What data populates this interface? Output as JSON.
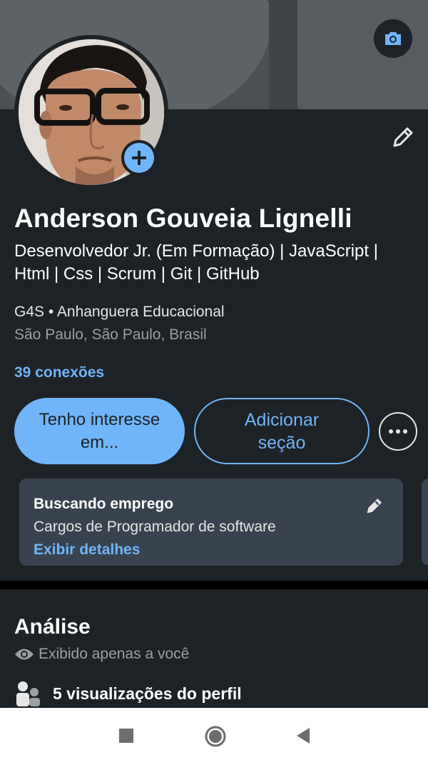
{
  "banner": {
    "camera_icon": "camera-icon"
  },
  "profile": {
    "name": "Anderson Gouveia Lignelli",
    "headline": "Desenvolvedor Jr. (Em Formação) | JavaScript | Html | Css | Scrum | Git | GitHub",
    "org": "G4S • Anhanguera Educacional",
    "location": "São Paulo, São Paulo, Brasil",
    "connections": "39 conexões",
    "add_photo_icon": "plus-icon",
    "edit_icon": "pencil-icon"
  },
  "actions": {
    "primary_label": "Tenho interesse em...",
    "secondary_label": "Adicionar seção",
    "more_icon": "more-horizontal-icon"
  },
  "open_to_work": {
    "title": "Buscando emprego",
    "description": "Cargos de Programador de software",
    "link": "Exibir detalhes",
    "edit_icon": "pencil-icon"
  },
  "analytics": {
    "title": "Análise",
    "private_note": "Exibido apenas a você",
    "profile_views": "5 visualizações do perfil",
    "eye_icon": "eye-icon",
    "people_icon": "people-icon"
  },
  "system_nav": {
    "recents_icon": "square-icon",
    "home_icon": "circle-icon",
    "back_icon": "triangle-back-icon"
  },
  "colors": {
    "background": "#1d2226",
    "accent": "#70b5f9",
    "card": "#38434f"
  }
}
